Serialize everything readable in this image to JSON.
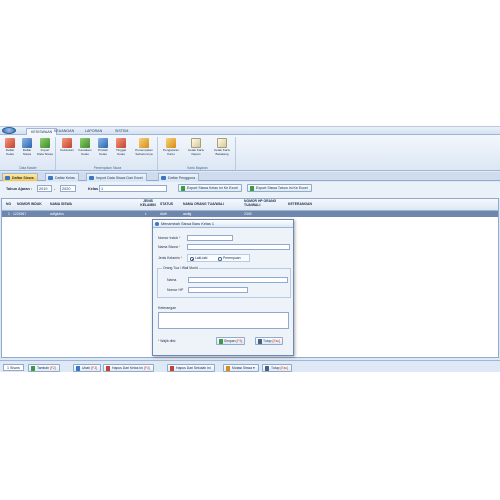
{
  "ribbon": {
    "tabs": [
      "KESISWAAN",
      "KEUANGAN",
      "LAPORAN",
      "SISTEM"
    ],
    "groups": [
      {
        "label": "Data Master",
        "buttons": [
          "Daftar Kelas",
          "Daftar Siswa",
          "Import Data Siswa"
        ]
      },
      {
        "label": "Penempatan Siswa",
        "buttons": [
          "Kelulusan",
          "Kenaikan Kelas",
          "Pindah Kelas",
          "Tinggal Kelas",
          "Penempatan Sebelumnya"
        ]
      },
      {
        "label": "Kartu Bayaran",
        "buttons": [
          "Pengaturan Kartu",
          "Cetak Kartu Depan",
          "Cetak Kartu Belakang"
        ]
      }
    ]
  },
  "doc_tabs": [
    "Daftar Siswa",
    "Daftar Kelas",
    "Import Data Siswa Dari Excel",
    "Daftar Pengguna"
  ],
  "filter": {
    "label_tahun": "Tahun Ajaran :",
    "year_from": "2019",
    "dash": "-",
    "year_to": "2020",
    "label_kelas": "Kelas",
    "kelas_value": "1",
    "btn_export_kelas": "Export Siswa Kelas Ini Ke Excel",
    "btn_export_tahun": "Export Siswa Tahun Ini Ke Excel"
  },
  "grid": {
    "headers": [
      "NO",
      "NOMOR INDUK",
      "NAMA SISWA",
      "JENIS KELAMIN",
      "STATUS",
      "NAMA ORANG TUA/WALI",
      "NOMOR HP ORANG TUA/WALI",
      "KETERANGAN"
    ],
    "rows": [
      [
        "1",
        "1224967",
        "adfgfuthu",
        "L",
        "Aktif",
        "asdfg",
        "2345",
        ""
      ]
    ]
  },
  "bottom": {
    "count": "1 Siswa",
    "btn_tambah": "Tambah",
    "hk_tambah": "[F2]",
    "btn_ubah": "Ubah",
    "hk_ubah": "[F3]",
    "btn_hapus_kelas": "Hapus Dari Kelas Ini",
    "hk_hapus_kelas": "[F4]",
    "btn_hapus_sekolah": "Hapus Dari Sekolah Ini",
    "btn_mutasi": "Mutasi Siswa",
    "btn_tutup": "Tutup",
    "hk_tutup": "[Esc]"
  },
  "modal": {
    "title": "Menambah Siswa Baru Kelas 1",
    "label_nomor_induk": "Nomor Induk",
    "label_nama_siswa": "Nama Siswa",
    "label_jenis_kelamin": "Jenis Kelamin",
    "req_mark": "*",
    "radio_laki": "Laki-laki",
    "radio_perempuan": "Perempuan",
    "group_ortu": "Orang Tua / Wali Murid",
    "label_nama": "Nama",
    "label_nomor_hp": "Nomor HP",
    "label_keterangan": "Keterangan",
    "note": "Wajib diisi",
    "btn_simpan": "Simpan",
    "hk_simpan": "[F5]",
    "btn_tutup": "Tutup",
    "hk_tutup": "[Esc]"
  }
}
